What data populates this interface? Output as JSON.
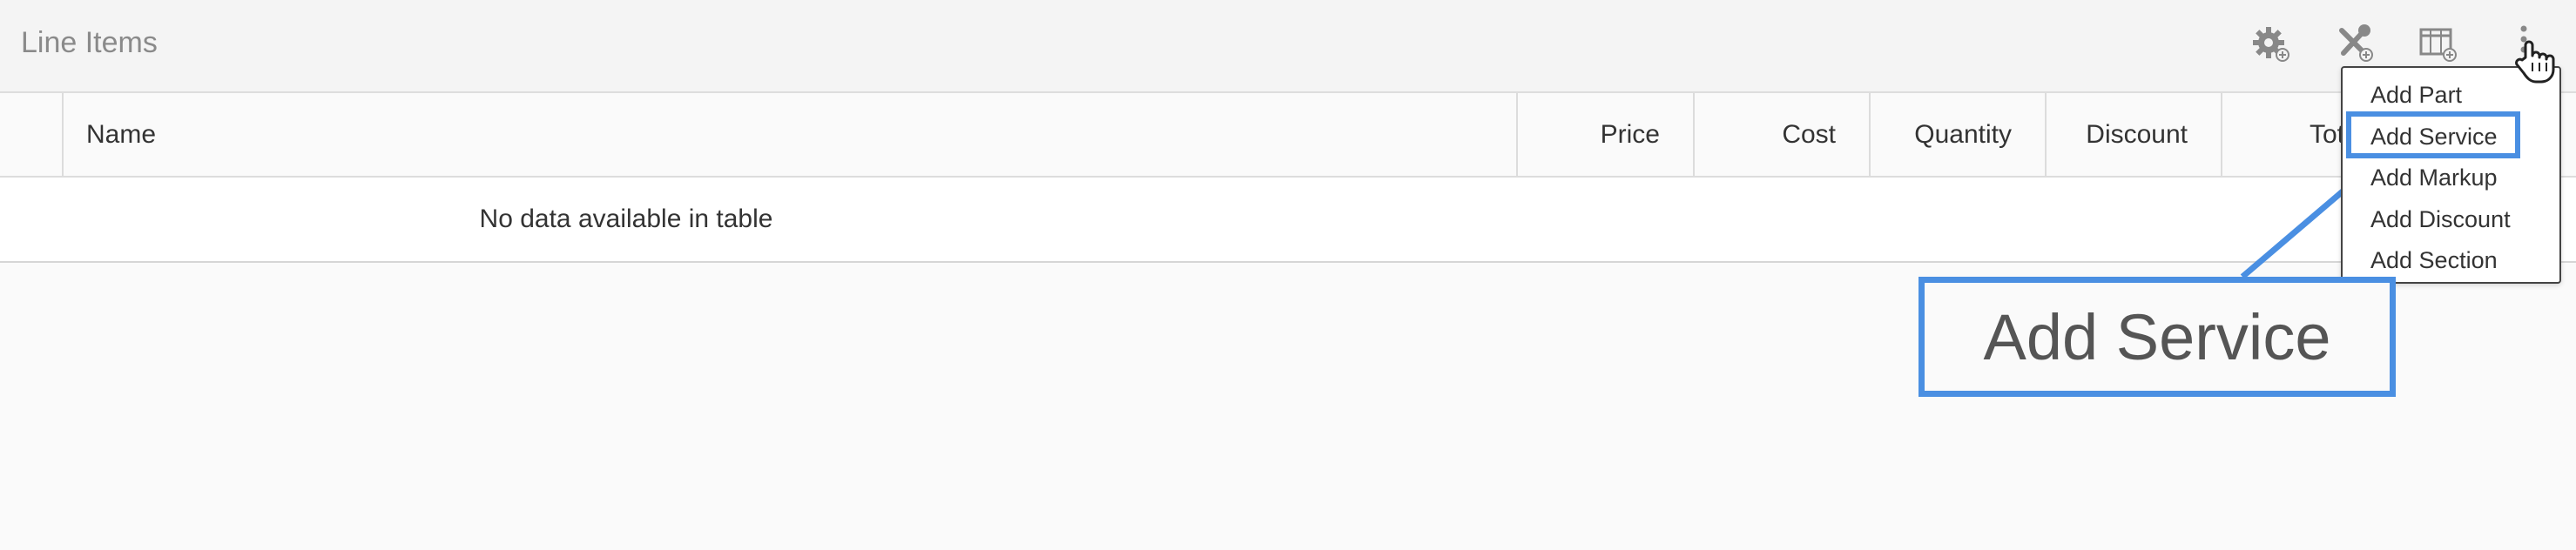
{
  "header": {
    "title": "Line Items",
    "tools": [
      {
        "icon": "gear-add-icon"
      },
      {
        "icon": "tools-add-icon"
      },
      {
        "icon": "columns-add-icon"
      },
      {
        "icon": "more-vertical-icon"
      }
    ]
  },
  "table": {
    "columns": [
      "Name",
      "Price",
      "Cost",
      "Quantity",
      "Discount",
      "Tot"
    ],
    "empty_message": "No data available in table"
  },
  "menu": {
    "items": [
      "Add Part",
      "Add Service",
      "Add Markup",
      "Add Discount",
      "Add Section"
    ],
    "highlighted": "Add Service"
  },
  "callout": {
    "text": "Add Service",
    "color": "#4a8fe2"
  }
}
